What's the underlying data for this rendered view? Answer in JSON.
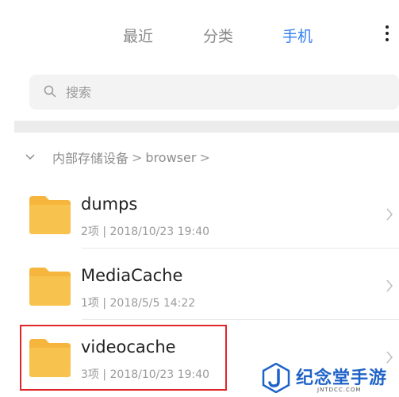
{
  "tabs": [
    {
      "label": "最近",
      "active": false
    },
    {
      "label": "分类",
      "active": false
    },
    {
      "label": "手机",
      "active": true
    }
  ],
  "search": {
    "placeholder": "搜索",
    "icon": "search-icon"
  },
  "breadcrumb": {
    "items": [
      "内部存储设备",
      "browser"
    ],
    "separator": ">"
  },
  "folders": [
    {
      "name": "dumps",
      "meta": "2项 | 2018/10/23 19:40"
    },
    {
      "name": "MediaCache",
      "meta": "1项 | 2018/5/5 14:22"
    },
    {
      "name": "videocache",
      "meta": "3项 | 2018/10/23 19:40"
    }
  ],
  "colors": {
    "accent": "#2f7ff6",
    "folder": "#f6b63e",
    "highlight": "#e0262a"
  },
  "watermark": {
    "text": "纪念堂手游",
    "url": "JNTDCC.COM"
  }
}
